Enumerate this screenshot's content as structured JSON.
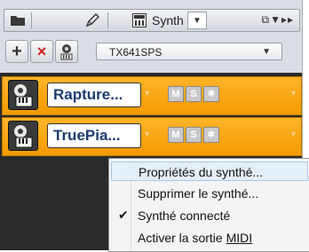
{
  "toolbar": {
    "synth_label": "Synth",
    "dropdown_arrow": "▼",
    "right_controls": "⧉▼▸▸"
  },
  "toolbar2": {
    "add_label": "+",
    "remove_label": "×",
    "preset_value": "TX641SPS",
    "preset_arrow": "▼"
  },
  "slots": [
    {
      "name": "Rapture...",
      "mute": "M",
      "solo": "S",
      "arm": "✱",
      "icon": "synth-icon"
    },
    {
      "name": "TruePia...",
      "mute": "M",
      "solo": "S",
      "arm": "✱",
      "icon": "synth-icon"
    }
  ],
  "menu": {
    "items": [
      {
        "label": "Propriétés du synthé...",
        "highlighted": true
      },
      {
        "label": "Supprimer le synthé...",
        "highlighted": false
      },
      {
        "label": "Synthé connecté",
        "checked": true
      },
      {
        "label_prefix": "Activer la sortie ",
        "label_underlined": "MIDI"
      }
    ],
    "check_mark": "✔"
  },
  "colors": {
    "accent_orange": "#f39a00",
    "highlight": "#e5effa",
    "remove_red": "#d0211c"
  }
}
